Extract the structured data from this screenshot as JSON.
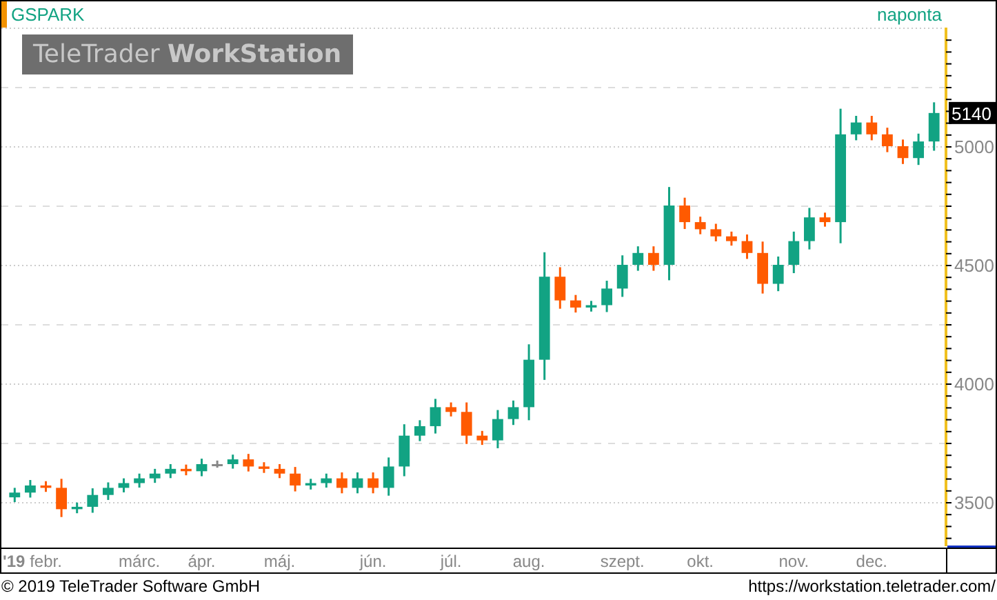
{
  "header": {
    "symbol": "GSPARK",
    "interval": "naponta"
  },
  "logo": "TeleTrader **WorkStation**",
  "chart": {
    "year_label": "'19",
    "last_price_label": "5140",
    "chart_data": {
      "type": "candlestick",
      "grid": true,
      "ylim": [
        3314,
        5500
      ],
      "yticks": [
        3500,
        4000,
        4500,
        5000
      ],
      "categories": [
        null,
        null,
        "febr.",
        null,
        null,
        null,
        null,
        null,
        "márc.",
        null,
        null,
        null,
        "ápr.",
        null,
        null,
        null,
        null,
        "máj.",
        null,
        null,
        null,
        null,
        null,
        "jún.",
        null,
        null,
        null,
        null,
        "júl.",
        null,
        null,
        null,
        null,
        "aug.",
        null,
        null,
        null,
        null,
        null,
        "szept.",
        null,
        null,
        null,
        null,
        "okt.",
        null,
        null,
        null,
        null,
        null,
        "nov.",
        null,
        null,
        null,
        null,
        "dec.",
        null,
        null,
        null,
        null
      ],
      "ohlc": [
        [
          3520,
          3560,
          3500,
          3540
        ],
        [
          3540,
          3593,
          3519,
          3570
        ],
        [
          3570,
          3588,
          3543,
          3560
        ],
        [
          3560,
          3598,
          3437,
          3470
        ],
        [
          3470,
          3498,
          3453,
          3480
        ],
        [
          3480,
          3558,
          3455,
          3530
        ],
        [
          3530,
          3583,
          3509,
          3560
        ],
        [
          3560,
          3600,
          3541,
          3580
        ],
        [
          3580,
          3620,
          3561,
          3600
        ],
        [
          3600,
          3640,
          3581,
          3620
        ],
        [
          3620,
          3660,
          3601,
          3640
        ],
        [
          3640,
          3658,
          3613,
          3630
        ],
        [
          3630,
          3683,
          3609,
          3660
        ],
        [
          3660,
          3675,
          3645,
          3660
        ],
        [
          3660,
          3700,
          3641,
          3680
        ],
        [
          3680,
          3703,
          3629,
          3650
        ],
        [
          3650,
          3668,
          3623,
          3640
        ],
        [
          3640,
          3660,
          3601,
          3620
        ],
        [
          3620,
          3648,
          3545,
          3570
        ],
        [
          3570,
          3598,
          3553,
          3580
        ],
        [
          3580,
          3620,
          3561,
          3600
        ],
        [
          3600,
          3625,
          3537,
          3560
        ],
        [
          3560,
          3625,
          3537,
          3600
        ],
        [
          3600,
          3625,
          3537,
          3560
        ],
        [
          3560,
          3688,
          3527,
          3650
        ],
        [
          3650,
          3828,
          3609,
          3780
        ],
        [
          3780,
          3845,
          3757,
          3820
        ],
        [
          3820,
          3935,
          3789,
          3900
        ],
        [
          3900,
          3920,
          3861,
          3880
        ],
        [
          3880,
          3920,
          3745,
          3780
        ],
        [
          3780,
          3800,
          3741,
          3760
        ],
        [
          3760,
          3888,
          3727,
          3850
        ],
        [
          3850,
          3928,
          3825,
          3900
        ],
        [
          3900,
          4165,
          3845,
          4100
        ],
        [
          4100,
          4553,
          4015,
          4450
        ],
        [
          4450,
          4490,
          4315,
          4350
        ],
        [
          4350,
          4373,
          4299,
          4320
        ],
        [
          4320,
          4348,
          4303,
          4330
        ],
        [
          4330,
          4433,
          4301,
          4400
        ],
        [
          4400,
          4540,
          4365,
          4500
        ],
        [
          4500,
          4578,
          4475,
          4550
        ],
        [
          4550,
          4578,
          4475,
          4500
        ],
        [
          4500,
          4828,
          4435,
          4750
        ],
        [
          4750,
          4783,
          4651,
          4680
        ],
        [
          4680,
          4703,
          4629,
          4650
        ],
        [
          4650,
          4673,
          4599,
          4620
        ],
        [
          4620,
          4640,
          4581,
          4600
        ],
        [
          4600,
          4628,
          4525,
          4550
        ],
        [
          4550,
          4598,
          4379,
          4420
        ],
        [
          4420,
          4535,
          4389,
          4500
        ],
        [
          4500,
          4640,
          4465,
          4600
        ],
        [
          4600,
          4740,
          4565,
          4700
        ],
        [
          4700,
          4720,
          4661,
          4680
        ],
        [
          4680,
          5158,
          4591,
          5050
        ],
        [
          5050,
          5128,
          5025,
          5100
        ],
        [
          5100,
          5128,
          5025,
          5050
        ],
        [
          5050,
          5078,
          4975,
          5000
        ],
        [
          5000,
          5028,
          4925,
          4950
        ],
        [
          4950,
          5053,
          4921,
          5020
        ],
        [
          5020,
          5185,
          4981,
          5140
        ]
      ]
    }
  },
  "footer": {
    "copyright": "© 2019 TeleTrader Software GmbH",
    "url": "https://workstation.teletrader.com/"
  }
}
